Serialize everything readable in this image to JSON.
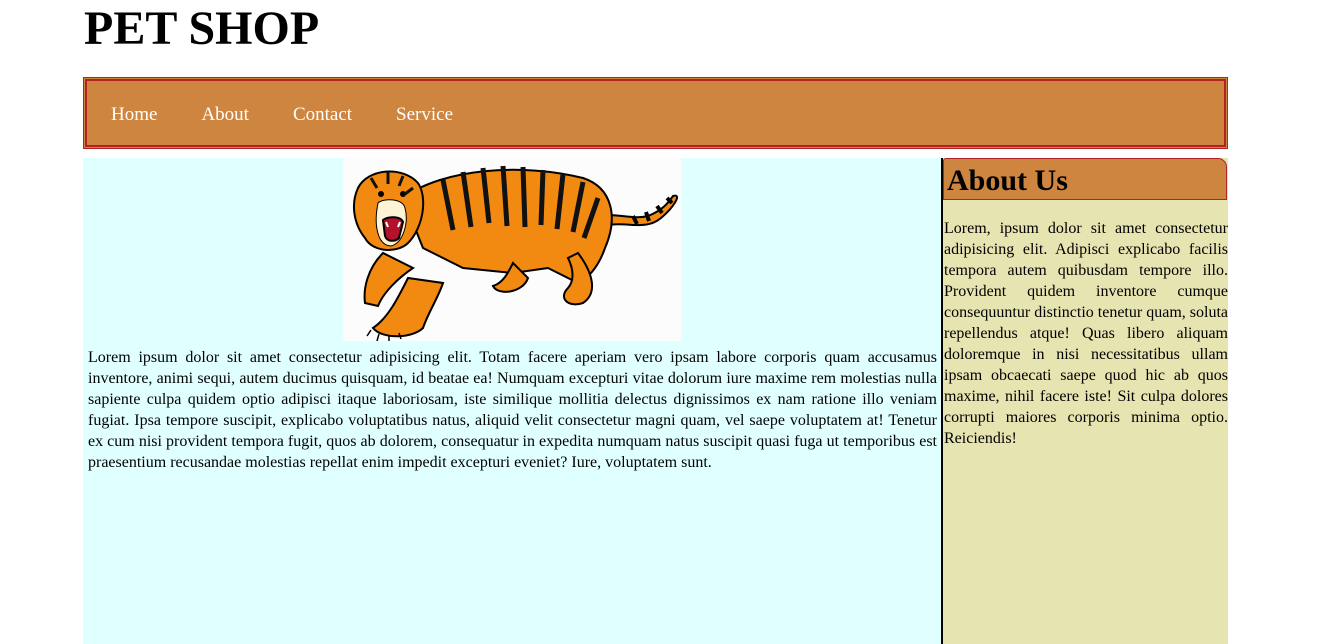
{
  "header": {
    "title": "PET SHOP"
  },
  "nav": {
    "items": [
      {
        "label": "Home"
      },
      {
        "label": "About"
      },
      {
        "label": "Contact"
      },
      {
        "label": "Service"
      }
    ]
  },
  "main": {
    "image": "tiger-illustration",
    "paragraph": "Lorem ipsum dolor sit amet consectetur adipisicing elit. Totam facere aperiam vero ipsam labore corporis quam accusamus inventore, animi sequi, autem ducimus quisquam, id beatae ea! Numquam excepturi vitae dolorum iure maxime rem molestias nulla sapiente culpa quidem optio adipisci itaque laboriosam, iste similique mollitia delectus dignissimos ex nam ratione illo veniam fugiat. Ipsa tempore suscipit, explicabo voluptatibus natus, aliquid velit consectetur magni quam, vel saepe voluptatem at! Tenetur ex cum nisi provident tempora fugit, quos ab dolorem, consequatur in expedita numquam natus suscipit quasi fuga ut temporibus est praesentium recusandae molestias repellat enim impedit excepturi eveniet? Iure, voluptatem sunt."
  },
  "sidebar": {
    "title": "About Us",
    "paragraph": "Lorem, ipsum dolor sit amet consectetur adipisicing elit. Adipisci explicabo facilis tempora autem quibusdam tempore illo. Provident quidem inventore cumque consequuntur distinctio tenetur quam, soluta repellendus atque! Quas libero aliquam doloremque in nisi necessitatibus ullam ipsam obcaecati saepe quod hic ab quos maxime, nihil facere iste! Sit culpa dolores corrupti maiores corporis minima optio. Reiciendis!"
  },
  "colors": {
    "nav_background": "#cd853f",
    "nav_border": "#b22222",
    "main_background": "#e0ffff",
    "sidebar_background": "#e6e4b0"
  }
}
